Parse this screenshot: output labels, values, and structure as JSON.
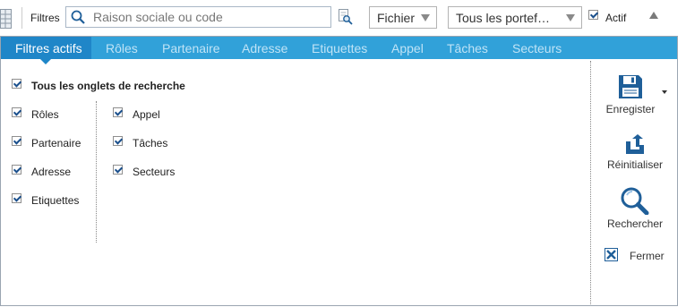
{
  "topbar": {
    "filtres_label": "Filtres",
    "search_placeholder": "Raison sociale ou code",
    "fichier_select": "Fichier",
    "portef_select": "Tous les portef…",
    "actif_label": "Actif",
    "actif_checked": true
  },
  "tabs": [
    {
      "label": "Filtres actifs",
      "active": true
    },
    {
      "label": "Rôles"
    },
    {
      "label": "Partenaire"
    },
    {
      "label": "Adresse"
    },
    {
      "label": "Etiquettes"
    },
    {
      "label": "Appel"
    },
    {
      "label": "Tâches"
    },
    {
      "label": "Secteurs"
    }
  ],
  "options": {
    "all": {
      "label": "Tous les onglets de recherche",
      "checked": true
    },
    "col1": [
      {
        "label": "Rôles",
        "checked": true
      },
      {
        "label": "Partenaire",
        "checked": true
      },
      {
        "label": "Adresse",
        "checked": true
      },
      {
        "label": "Etiquettes",
        "checked": true
      }
    ],
    "col2": [
      {
        "label": "Appel",
        "checked": true
      },
      {
        "label": "Tâches",
        "checked": true
      },
      {
        "label": "Secteurs",
        "checked": true
      }
    ]
  },
  "actions": {
    "save": "Enregister",
    "reset": "Réinitialiser",
    "search": "Rechercher",
    "close": "Fermer"
  },
  "icons": {
    "accent": "#31a1d9",
    "active_tab": "#1f86c8",
    "action_icon": "#1f5f99"
  }
}
